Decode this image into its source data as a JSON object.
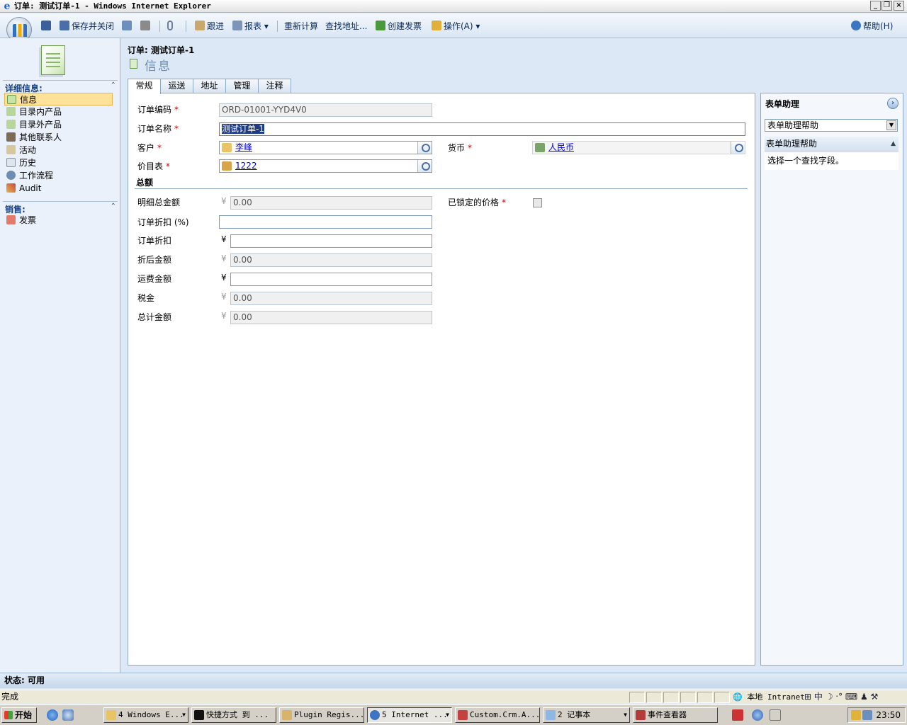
{
  "window": {
    "title": "订单: 测试订单-1 - Windows Internet Explorer"
  },
  "toolbar": {
    "save_close": "保存并关闭",
    "follow_up": "跟进",
    "reports": "报表",
    "recalculate": "重新计算",
    "lookup_address": "查找地址...",
    "create_invoice": "创建发票",
    "actions": "操作(A)",
    "help": "帮助(H)"
  },
  "leftnav": {
    "details_header": "详细信息:",
    "items": [
      {
        "label": "信息",
        "icon": "form-icon",
        "selected": true
      },
      {
        "label": "目录内产品",
        "icon": "product-icon"
      },
      {
        "label": "目录外产品",
        "icon": "product-icon"
      },
      {
        "label": "其他联系人",
        "icon": "contact-icon"
      },
      {
        "label": "活动",
        "icon": "activity-icon"
      },
      {
        "label": "历史",
        "icon": "history-icon"
      },
      {
        "label": "工作流程",
        "icon": "workflow-icon"
      },
      {
        "label": "Audit",
        "icon": "audit-icon"
      }
    ],
    "sales_header": "销售:",
    "sales_items": [
      {
        "label": "发票",
        "icon": "invoice-icon"
      }
    ]
  },
  "header": {
    "record_title": "订单: 测试订单-1",
    "section_title": "信息"
  },
  "tabs": [
    "常规",
    "运送",
    "地址",
    "管理",
    "注释"
  ],
  "form": {
    "order_id_label": "订单编码",
    "order_id_value": "ORD-01001-YYD4V0",
    "order_name_label": "订单名称",
    "order_name_value": "测试订单-1",
    "customer_label": "客户",
    "customer_value": "李峰",
    "currency_label": "货币",
    "currency_value": "人民币",
    "pricelist_label": "价目表",
    "pricelist_value": "1222",
    "totals_header": "总额",
    "detail_amount_label": "明细总金额",
    "detail_amount_value": "0.00",
    "prices_locked_label": "已锁定的价格",
    "discount_pct_label": "订单折扣 (%)",
    "discount_pct_value": "",
    "discount_label": "订单折扣",
    "discount_value": "",
    "pre_freight_label": "折后金额",
    "pre_freight_value": "0.00",
    "freight_label": "运费金额",
    "freight_value": "",
    "tax_label": "税金",
    "tax_value": "0.00",
    "total_label": "总计金额",
    "total_value": "0.00",
    "currency_symbol": "¥",
    "required_mark": "*"
  },
  "assistant": {
    "title": "表单助理",
    "dropdown_value": "表单助理帮助",
    "subheader": "表单助理帮助",
    "body": "选择一个查找字段。"
  },
  "status": {
    "crm_status": "状态: 可用",
    "ie_status": "完成",
    "zone": "本地 Intranet"
  },
  "taskbar": {
    "start": "开始",
    "tasks": [
      "4 Windows E...",
      "快捷方式 到 ...",
      "Plugin Regis...",
      "5 Internet ...",
      "Custom.Crm.A...",
      "2 记事本",
      "事件查看器"
    ],
    "ime": "中",
    "clock": "23:50"
  },
  "colors": {
    "accent": "#15428b",
    "selected_nav": "#ffe29a",
    "required": "#cc0000"
  }
}
